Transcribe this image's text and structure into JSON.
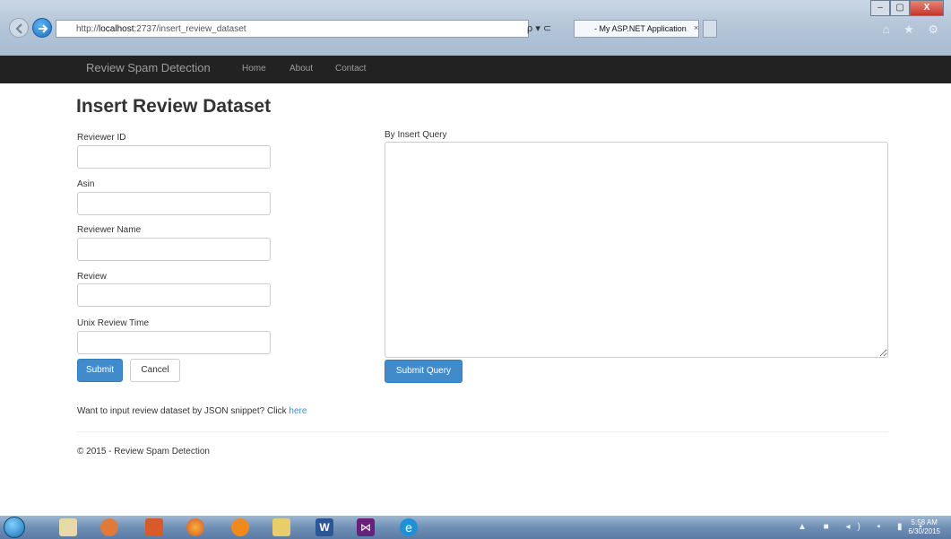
{
  "browser": {
    "url_prefix": "http://",
    "url_host": "localhost",
    "url_rest": ":2737/insert_review_dataset",
    "search_refresh": "ρ ▾ ⊂",
    "tab_title": "- My ASP.NET Application",
    "tab_close": "×",
    "window_controls": [
      "–",
      "▢",
      "X"
    ],
    "toolbar_icons": "⌂ ★ ⚙"
  },
  "navbar": {
    "brand": "Review Spam Detection",
    "links": [
      "Home",
      "About",
      "Contact"
    ]
  },
  "page": {
    "title": "Insert Review Dataset",
    "fields": [
      {
        "label": "Reviewer ID",
        "value": ""
      },
      {
        "label": "Asin",
        "value": ""
      },
      {
        "label": "Reviewer Name",
        "value": ""
      },
      {
        "label": "Review",
        "value": ""
      },
      {
        "label": "Unix Review Time",
        "value": ""
      }
    ],
    "submit_label": "Submit",
    "cancel_label": "Cancel",
    "query_label": "By Insert Query",
    "query_value": "",
    "submit_query_label": "Submit Query",
    "json_prompt": "Want to input review dataset by JSON snippet? Click",
    "json_link": "here",
    "footer": "© 2015 - Review Spam Detection"
  },
  "taskbar": {
    "tray_icons": "▲ ■ ◂) ▪ ▮ ▪",
    "clock_time": "5:58 AM",
    "clock_date": "6/30/2015",
    "apps": [
      "W",
      "⋈",
      "e"
    ]
  },
  "colors": {
    "navbar_bg": "#222222",
    "primary": "#428bca",
    "link": "#428bca"
  }
}
